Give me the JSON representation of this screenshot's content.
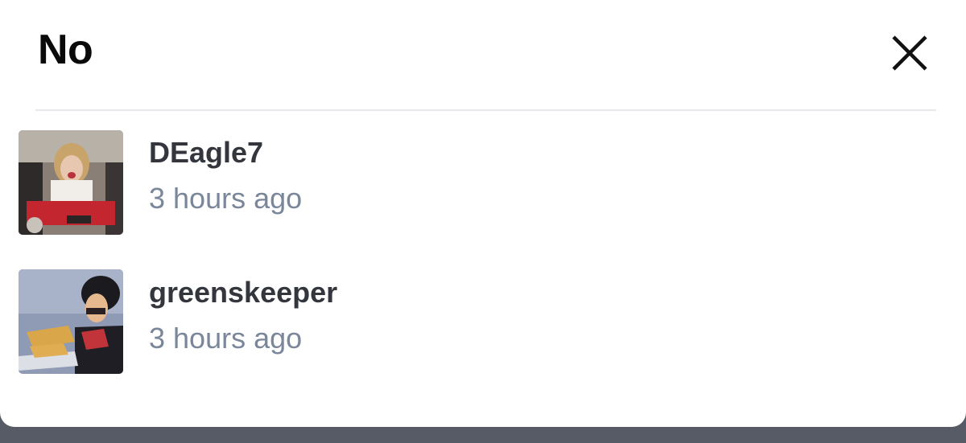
{
  "modal": {
    "title": "No",
    "close_icon": "close-icon"
  },
  "voters": [
    {
      "username": "DEagle7",
      "time": "3 hours ago",
      "avatar_icon": "user-avatar-photo"
    },
    {
      "username": "greenskeeper",
      "time": "3 hours ago",
      "avatar_icon": "user-avatar-cartoon"
    }
  ],
  "colors": {
    "title": "#0a0a0a",
    "username": "#33373d",
    "timestamp": "#7a8699",
    "divider": "#e6e8ec",
    "backdrop": "#5f6470"
  }
}
